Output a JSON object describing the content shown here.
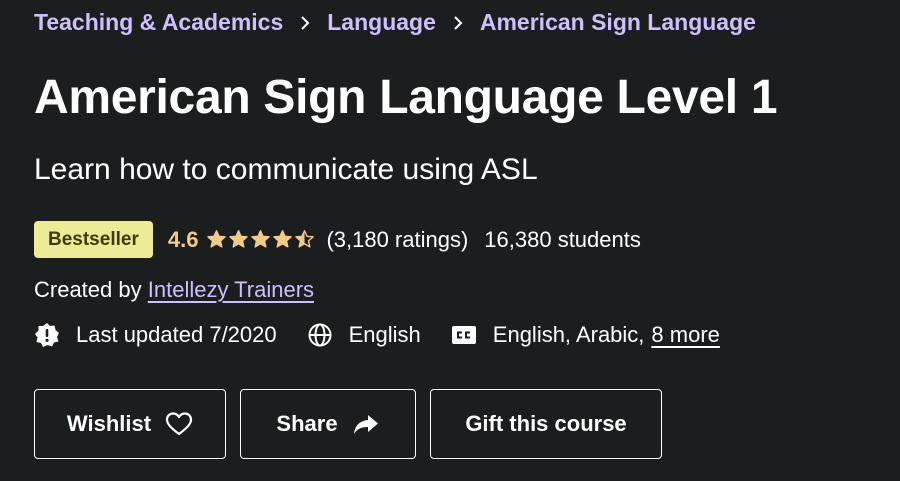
{
  "breadcrumb": [
    "Teaching & Academics",
    "Language",
    "American Sign Language"
  ],
  "course": {
    "title": "American Sign Language Level 1",
    "subtitle": "Learn how to communicate using ASL"
  },
  "rating": {
    "badge": "Bestseller",
    "value": "4.6",
    "stars_filled": 4.5,
    "ratings_count": "(3,180 ratings)",
    "students": "16,380 students"
  },
  "creator": {
    "prefix": "Created by",
    "name": "Intellezy Trainers"
  },
  "meta": {
    "last_updated": "Last updated 7/2020",
    "language": "English",
    "captions": "English, Arabic,",
    "captions_more": "8 more"
  },
  "actions": {
    "wishlist": "Wishlist",
    "share": "Share",
    "gift": "Gift this course"
  },
  "colors": {
    "background": "#1c1d1f",
    "breadcrumb": "#cec0fc",
    "badge_bg": "#eceb98",
    "rating": "#f3ca8c"
  }
}
